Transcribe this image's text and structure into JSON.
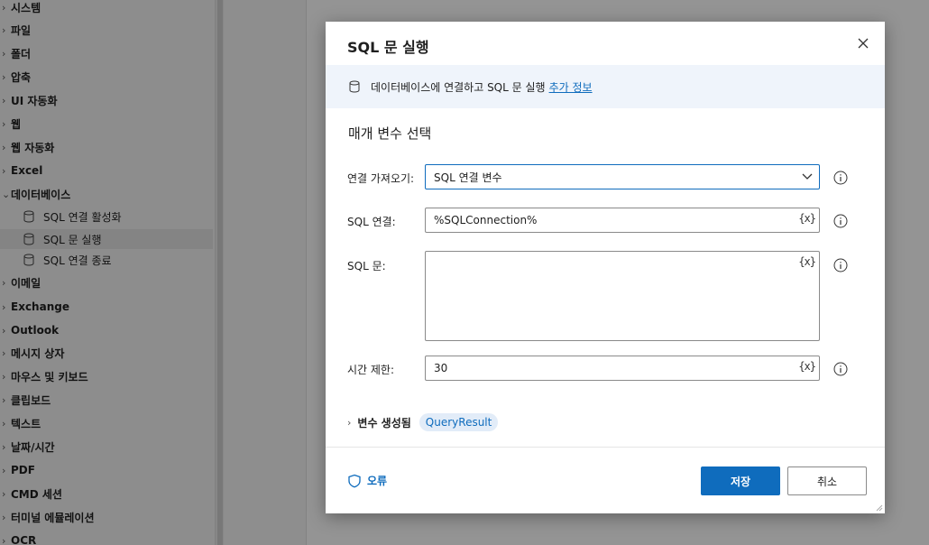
{
  "sidebar": {
    "categories": [
      {
        "label": "시스템"
      },
      {
        "label": "파일"
      },
      {
        "label": "폴더"
      },
      {
        "label": "압축"
      },
      {
        "label": "UI 자동화"
      },
      {
        "label": "웹"
      },
      {
        "label": "웹 자동화"
      },
      {
        "label": "Excel"
      },
      {
        "label": "데이터베이스"
      },
      {
        "label": "이메일"
      },
      {
        "label": "Exchange"
      },
      {
        "label": "Outlook"
      },
      {
        "label": "메시지 상자"
      },
      {
        "label": "마우스 및 키보드"
      },
      {
        "label": "클립보드"
      },
      {
        "label": "텍스트"
      },
      {
        "label": "날짜/시간"
      },
      {
        "label": "PDF"
      },
      {
        "label": "CMD 세션"
      },
      {
        "label": "터미널 에뮬레이션"
      },
      {
        "label": "OCR"
      }
    ],
    "database_actions": [
      {
        "label": "SQL 연결 활성화",
        "icon": "database-icon"
      },
      {
        "label": "SQL 문 실행",
        "icon": "database-icon",
        "selected": true
      },
      {
        "label": "SQL 연결 종료",
        "icon": "database-icon"
      }
    ]
  },
  "dialog": {
    "title": "SQL 문 실행",
    "info_text": "데이터베이스에 연결하고 SQL 문 실행",
    "info_link": "추가 정보",
    "section_title": "매개 변수 선택",
    "fields": {
      "connection_source": {
        "label": "연결 가져오기:",
        "value": "SQL 연결 변수"
      },
      "sql_connection": {
        "label": "SQL 연결:",
        "value": "%SQLConnection%",
        "var_button": "{x}"
      },
      "sql_statement": {
        "label": "SQL 문:",
        "value": "",
        "var_button": "{x}"
      },
      "timeout": {
        "label": "시간 제한:",
        "value": "30",
        "var_button": "{x}"
      }
    },
    "variables": {
      "label": "변수 생성됨",
      "chip": "QueryResult"
    },
    "footer": {
      "error_label": "오류",
      "save_label": "저장",
      "cancel_label": "취소"
    },
    "colors": {
      "accent": "#0f6cbd",
      "info_bg": "#eff4fb"
    }
  }
}
